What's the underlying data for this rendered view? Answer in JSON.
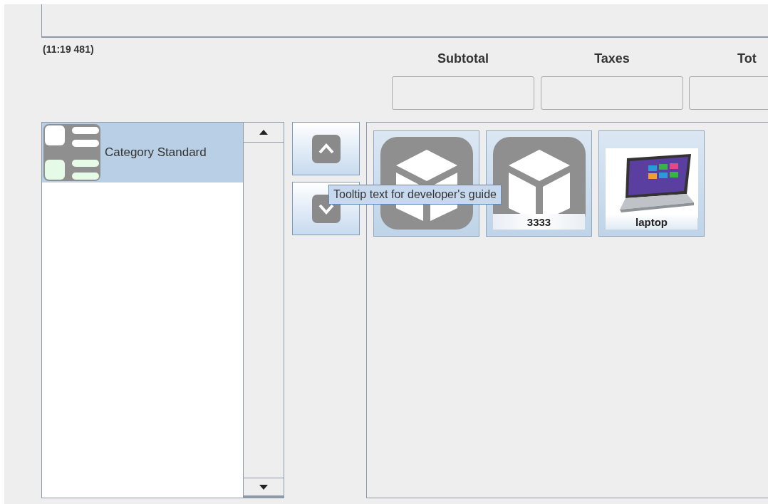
{
  "ticket_time": "(11:19 481)",
  "totals": [
    {
      "label": "Subtotal"
    },
    {
      "label": "Taxes"
    },
    {
      "label": "Tot"
    }
  ],
  "categories": [
    {
      "label": "Category Standard",
      "selected": true
    }
  ],
  "products": [
    {
      "kind": "generic"
    },
    {
      "kind": "generic",
      "label": "3333"
    },
    {
      "kind": "photo",
      "label": "laptop"
    }
  ],
  "tooltip": "Tooltip text for developer's guide"
}
